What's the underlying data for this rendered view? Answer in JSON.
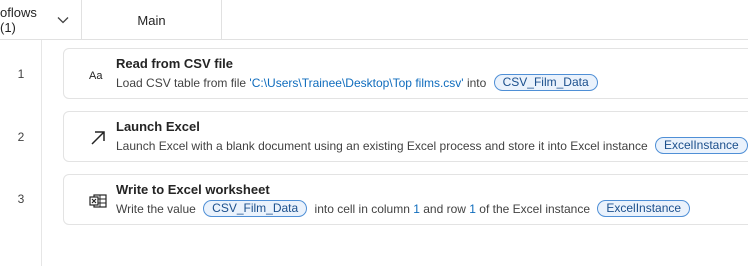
{
  "tabs": {
    "subflows_label": "oflows (1)",
    "main_label": "Main"
  },
  "actions": [
    {
      "line": "1",
      "icon": "text-aa-icon",
      "title": "Read from CSV file",
      "desc_prefix": "Load CSV table from file ",
      "file_path": "'C:\\Users\\Trainee\\Desktop\\Top films.csv'",
      "desc_mid": " into ",
      "variable": "CSV_Film_Data"
    },
    {
      "line": "2",
      "icon": "launch-arrow-icon",
      "title": "Launch Excel",
      "desc_prefix": "Launch Excel with a blank document using an existing Excel process and store it into Excel instance ",
      "variable": "ExcelInstance"
    },
    {
      "line": "3",
      "icon": "excel-worksheet-icon",
      "title": "Write to Excel worksheet",
      "desc_prefix": "Write the value ",
      "value_var": "CSV_Film_Data",
      "desc_mid1": " into cell in column ",
      "column": "1",
      "desc_mid2": " and row ",
      "row": "1",
      "desc_mid3": " of the Excel instance ",
      "instance_var": "ExcelInstance"
    }
  ]
}
